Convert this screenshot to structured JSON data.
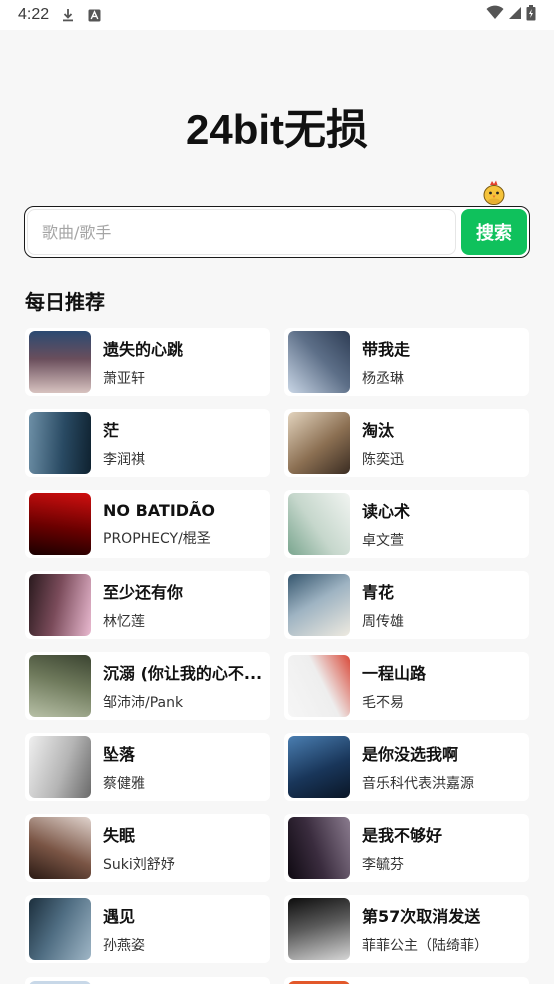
{
  "status_bar": {
    "time": "4:22",
    "icons": [
      "download-icon",
      "font-a-icon",
      "wifi-icon",
      "signal-icon",
      "battery-icon"
    ]
  },
  "app": {
    "title": "24bit无损"
  },
  "search": {
    "placeholder": "歌曲/歌手",
    "value": "",
    "button_label": "搜索"
  },
  "section": {
    "title": "每日推荐"
  },
  "colors": {
    "accent": "#0fc15c",
    "background": "#f7f7f7",
    "card": "#ffffff"
  },
  "songs": [
    {
      "title": "遗失的心跳",
      "artist": "萧亚轩",
      "cover": [
        "#d8c3c0",
        "#6a4e5c",
        "#2b4a72"
      ]
    },
    {
      "title": "带我走",
      "artist": "杨丞琳",
      "cover": [
        "#c9d6e6",
        "#5d6f88",
        "#2e3d55"
      ]
    },
    {
      "title": "茫",
      "artist": "李润祺",
      "cover": [
        "#6d8fa6",
        "#294a63",
        "#0f2230"
      ]
    },
    {
      "title": "淘汰",
      "artist": "陈奕迅",
      "cover": [
        "#e2d3bd",
        "#8b6f52",
        "#3a2c22"
      ]
    },
    {
      "title": "NO BATIDÃO",
      "artist": "PROPHECY/棍圣",
      "cover": [
        "#d01010",
        "#6a0000",
        "#1a0000"
      ]
    },
    {
      "title": "读心术",
      "artist": "卓文萱",
      "cover": [
        "#f1f4f1",
        "#c6d7cc",
        "#7aa68f"
      ]
    },
    {
      "title": "至少还有你",
      "artist": "林忆莲",
      "cover": [
        "#e9b9d0",
        "#7a4b5a",
        "#2a1a1e"
      ]
    },
    {
      "title": "青花",
      "artist": "周传雄",
      "cover": [
        "#eeeae0",
        "#9eb3c2",
        "#35566e"
      ]
    },
    {
      "title": "沉溺 (你让我的心不...",
      "artist": "邹沛沛/Pank",
      "cover": [
        "#b7c0a6",
        "#6f7a5c",
        "#3b4431"
      ]
    },
    {
      "title": "一程山路",
      "artist": "毛不易",
      "cover": [
        "#f6f6f6",
        "#eeeeee",
        "#d94a3a"
      ]
    },
    {
      "title": "坠落",
      "artist": "蔡健雅",
      "cover": [
        "#efefef",
        "#b5b5b5",
        "#6a6a6a"
      ]
    },
    {
      "title": "是你没选我啊",
      "artist": "音乐科代表洪嘉源",
      "cover": [
        "#4a7eb1",
        "#19365a",
        "#0a1626"
      ]
    },
    {
      "title": "失眠",
      "artist": "Suki刘舒妤",
      "cover": [
        "#e0d3cd",
        "#7a5545",
        "#2a1a14"
      ]
    },
    {
      "title": "是我不够好",
      "artist": "李毓芬",
      "cover": [
        "#8a7b8e",
        "#3a2c3e",
        "#0f0a12"
      ]
    },
    {
      "title": "遇见",
      "artist": "孙燕姿",
      "cover": [
        "#9fb6c6",
        "#4f6d82",
        "#1c2f3d"
      ]
    },
    {
      "title": "第57次取消发送",
      "artist": "菲菲公主（陆绮菲）",
      "cover": [
        "#d6d6d6",
        "#5a5a5a",
        "#0d0d0d"
      ]
    }
  ]
}
